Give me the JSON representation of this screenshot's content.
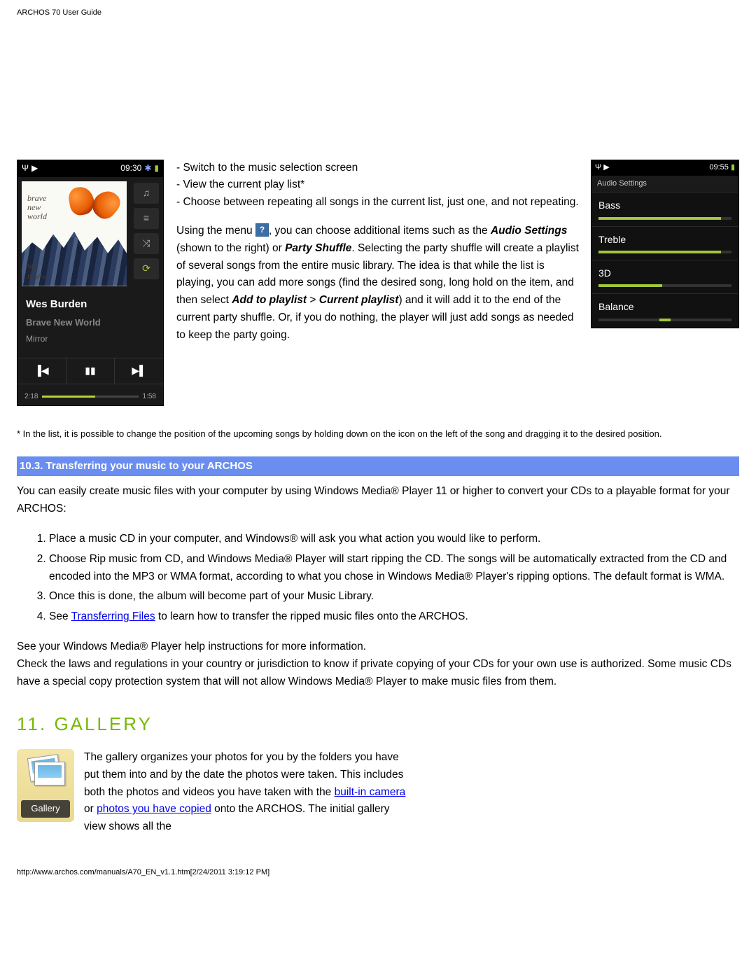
{
  "header": "ARCHOS 70 User Guide",
  "music_player": {
    "status_time": "09:30",
    "artist": "Wes Burden",
    "album": "Brave New World",
    "track": "Mirror",
    "elapsed": "2:18",
    "total": "1:58",
    "album_art_text": "brave\nnew\nworld",
    "album_sig": "Wes\nBurden"
  },
  "audio_settings": {
    "status_time": "09:55",
    "title": "Audio Settings",
    "rows": [
      {
        "label": "Bass",
        "fill": 92
      },
      {
        "label": "Treble",
        "fill": 92
      },
      {
        "label": "3D",
        "fill": 48
      },
      {
        "label": "Balance",
        "center": true,
        "pos": 50
      }
    ]
  },
  "bullets": [
    "- Switch to the music selection screen",
    "- View the current play list*",
    "- Choose between repeating all songs in the current list, just one, and not repeating."
  ],
  "para1_a": "Using the menu ",
  "para1_b": ", you can choose additional items such as the ",
  "para1_bold1": "Audio Settings",
  "para1_c": " (shown to the right) or ",
  "para1_bold2": "Party Shuffle",
  "para1_d": ". Selecting the party shuffle will create a playlist of several songs from the entire music library. The idea is that while the list is playing, you can add more songs (find the desired song, long hold on the item, and then select ",
  "para1_bold3": "Add to playlist",
  "para1_e": " > ",
  "para1_bold4": "Current playlist",
  "para1_f": ") and it will add it to the end of the current party shuffle. Or, if you do nothing, the player will just add songs as needed to keep the party going.",
  "footnote": "* In the list, it is possible to change the position of the upcoming songs by holding down on the icon on the left of the song and dragging it to the desired position.",
  "section_10_3": "10.3. Transferring your music to your ARCHOS",
  "s10_3_intro": "You can easily create music files with your computer by using Windows Media® Player 11 or higher to convert your CDs to a playable format for your ARCHOS:",
  "steps": [
    "Place a music CD in your computer, and Windows® will ask you what action you would like to perform.",
    "Choose Rip music from CD, and Windows Media® Player will start ripping the CD. The songs will be automatically extracted from the CD and encoded into the MP3 or WMA format, according to what you chose in Windows Media® Player's ripping options. The default format is WMA.",
    "Once this is done, the album will become part of your Music Library."
  ],
  "step4_a": "See ",
  "step4_link": "Transferring Files",
  "step4_b": " to learn how to transfer the ripped music files onto the ARCHOS.",
  "s10_3_after1": "See your Windows Media® Player help instructions for more information.",
  "s10_3_after2": "Check the laws and regulations in your country or jurisdiction to know if private copying of your CDs for your own use is authorized. Some music CDs have a special copy protection system that will not allow Windows Media® Player to make music files from them.",
  "gallery_heading": "11. GALLERY",
  "gallery_icon_label": "Gallery",
  "gallery_p_a": "The gallery organizes your photos for you by the folders you have put them into and by the date the photos were taken. This includes both the photos and videos you have taken with the ",
  "gallery_link1": "built-in camera",
  "gallery_p_b": " or ",
  "gallery_link2": "photos you have copied",
  "gallery_p_c": " onto the ARCHOS. The initial gallery view shows all the",
  "footer": "http://www.archos.com/manuals/A70_EN_v1.1.htm[2/24/2011 3:19:12 PM]"
}
